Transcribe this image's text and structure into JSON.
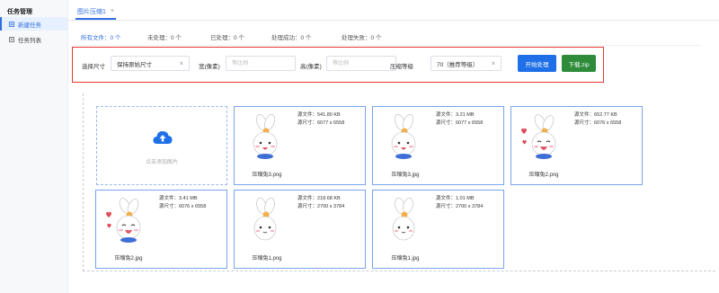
{
  "sidebar": {
    "title": "任务管理",
    "items": [
      {
        "label": "新建任务",
        "icon": "new-task-icon",
        "active": true
      },
      {
        "label": "任务列表",
        "icon": "list-icon",
        "active": false
      }
    ]
  },
  "tabs": [
    {
      "label": "图片压缩1",
      "close": "×"
    }
  ],
  "stats": [
    "所有文件：0 个",
    "未处理：0 个",
    "已处理：0 个",
    "处理成功：0 个",
    "处理失败：0 个"
  ],
  "controls": {
    "size_label": "选择尺寸",
    "size_value": "保持原始尺寸",
    "width_label": "宽(像素)",
    "width_placeholder": "等比例",
    "height_label": "高(像素)",
    "height_placeholder": "等比例",
    "level_label": "压缩等级",
    "level_value": "70（推荐等级）",
    "start_label": "开始处理",
    "download_label": "下载.zip"
  },
  "upload": {
    "label": "点击添加图片",
    "icon": "cloud-upload-icon"
  },
  "cards": [
    {
      "size": "源文件：541.80 KB",
      "dims": "源尺寸：6077 x 6558",
      "name": "压缩兔3.png",
      "variant": "happy"
    },
    {
      "size": "源文件：3.21 MB",
      "dims": "源尺寸：6077 x 6558",
      "name": "压缩兔3.jpg",
      "variant": "happy"
    },
    {
      "size": "源文件：652.77 KB",
      "dims": "源尺寸：6076 x 6558",
      "name": "压缩兔2.png",
      "variant": "love"
    },
    {
      "size": "源文件：3.41 MB",
      "dims": "源尺寸：6076 x 6558",
      "name": "压缩兔2.jpg",
      "variant": "love"
    },
    {
      "size": "源文件：218.68 KB",
      "dims": "源尺寸：2700 x 3784",
      "name": "压缩兔1.png",
      "variant": "plain"
    },
    {
      "size": "源文件：1.01 MB",
      "dims": "源尺寸：2700 x 3784",
      "name": "压缩兔1.jpg",
      "variant": "plain"
    }
  ],
  "colors": {
    "accent": "#1e6fe8",
    "success": "#2e8b3a",
    "highlight_border": "#e53935"
  }
}
